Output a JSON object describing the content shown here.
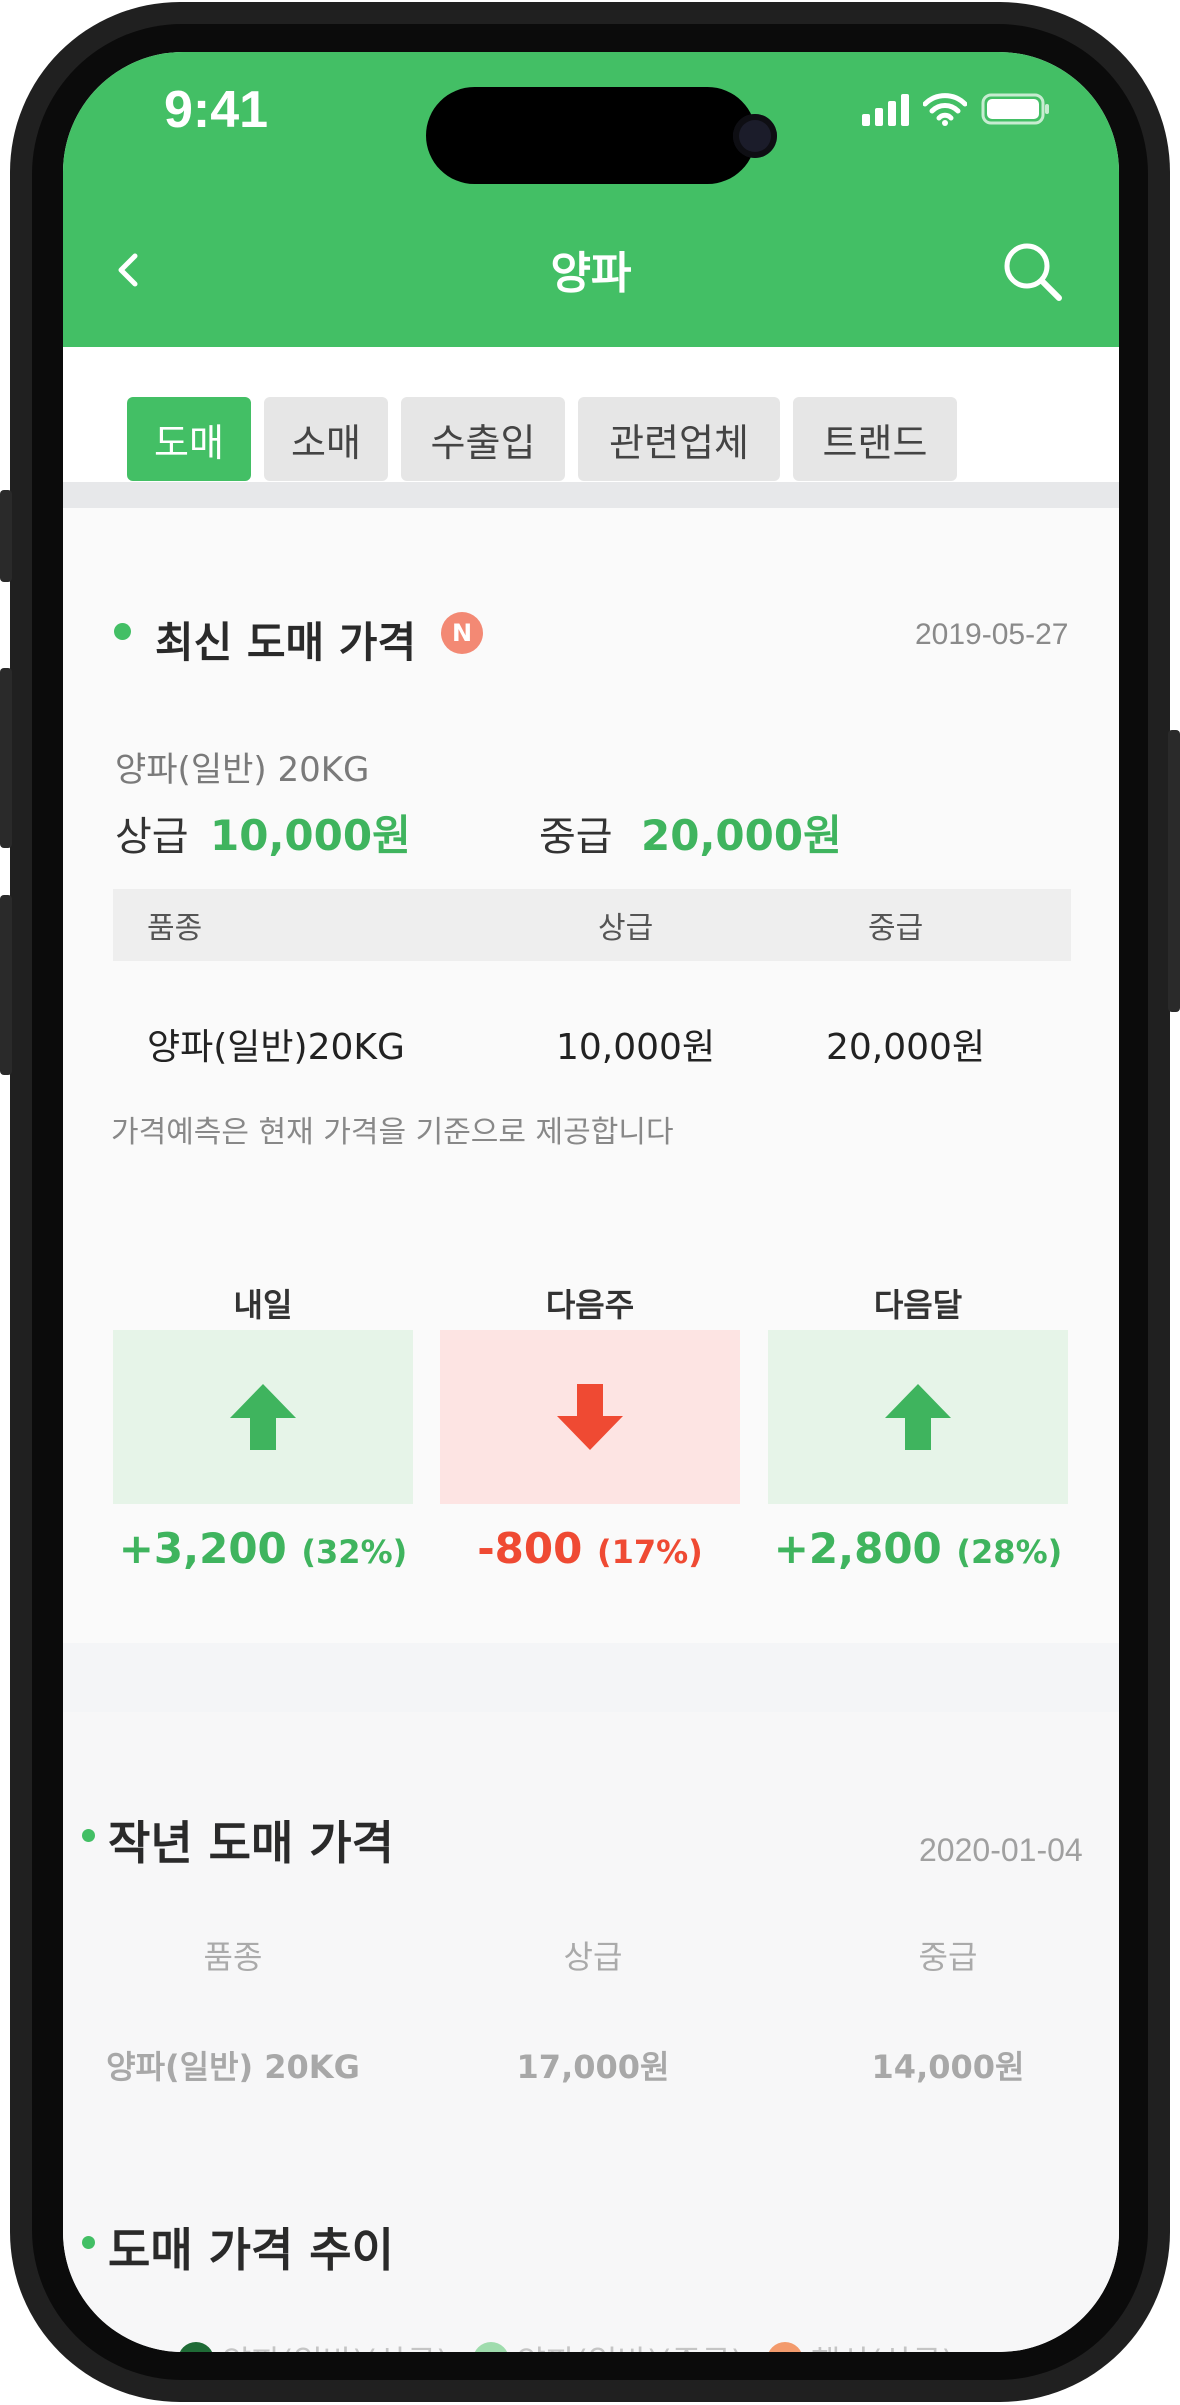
{
  "status_bar": {
    "time": "9:41"
  },
  "header": {
    "title": "양파"
  },
  "tabs": [
    {
      "label": "도매",
      "active": true
    },
    {
      "label": "소매",
      "active": false
    },
    {
      "label": "수출입",
      "active": false
    },
    {
      "label": "관련업체",
      "active": false
    },
    {
      "label": "트랜드",
      "active": false
    }
  ],
  "latest": {
    "title": "최신 도매 가격",
    "badge": "N",
    "date": "2019-05-27",
    "product": "양파(일반) 20KG",
    "upper_label": "상급",
    "upper_price": "10,000원",
    "middle_label": "중급",
    "middle_price": "20,000원",
    "table": {
      "headers": [
        "품종",
        "상급",
        "중급"
      ],
      "rows": [
        [
          "양파(일반)20KG",
          "10,000원",
          "20,000원"
        ]
      ]
    },
    "note": "가격예측은 현재 가격을 기준으로 제공합니다"
  },
  "forecast": [
    {
      "label": "내일",
      "direction": "up",
      "change": "+3,200",
      "percent": "(32%)"
    },
    {
      "label": "다음주",
      "direction": "down",
      "change": "-800",
      "percent": "(17%)"
    },
    {
      "label": "다음달",
      "direction": "up",
      "change": "+2,800",
      "percent": "(28%)"
    }
  ],
  "last_year": {
    "title": "작년 도매 가격",
    "date": "2020-01-04",
    "headers": [
      "품종",
      "상급",
      "중급"
    ],
    "row": [
      "양파(일반) 20KG",
      "17,000원",
      "14,000원"
    ]
  },
  "trend": {
    "title": "도매 가격 추이",
    "legend": [
      {
        "label": "양파(일반)(상급)",
        "color": "#1f6b36"
      },
      {
        "label": "양파(일반)(중급)",
        "color": "#9fdcad"
      },
      {
        "label": "햇산(상급)",
        "color": "#f39b6d"
      }
    ]
  },
  "colors": {
    "brand": "#43bf65",
    "up": "#3fb45e",
    "down": "#ef4a33"
  }
}
